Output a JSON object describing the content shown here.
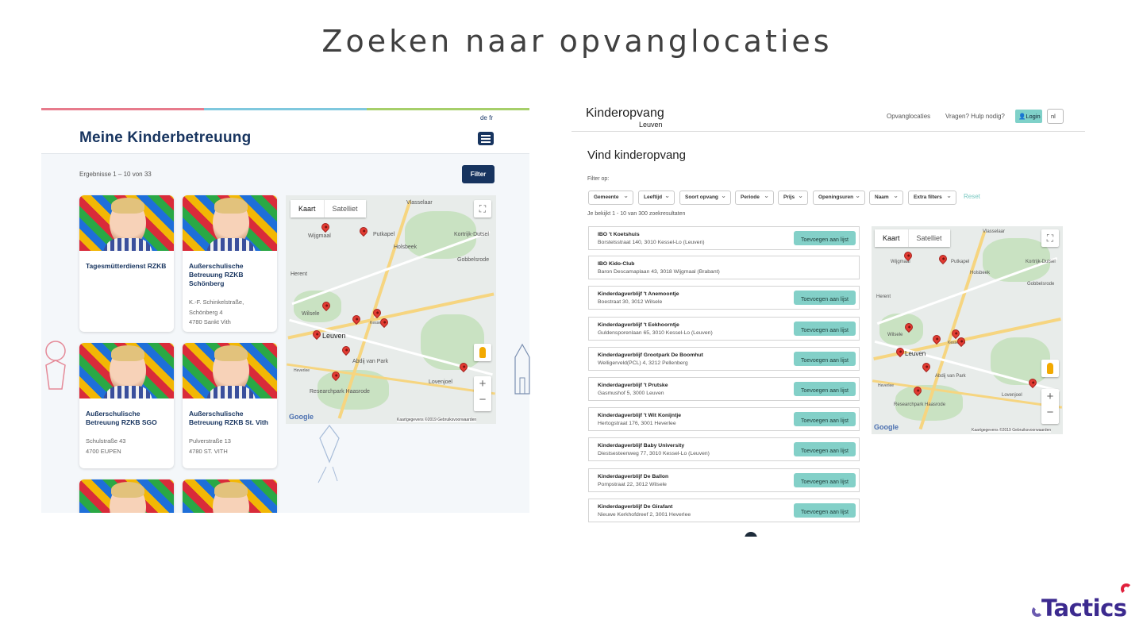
{
  "slide": {
    "title": "Zoeken naar opvanglocaties"
  },
  "left": {
    "lang_links": "de   fr",
    "title": "Meine Kinderbetreuung",
    "results": "Ergebnisse 1 – 10 von 33",
    "filter_label": "Filter",
    "cards": [
      {
        "name": "Tagesmütterdienst RZKB",
        "address": []
      },
      {
        "name": "Außerschulische Betreuung RZKB Schönberg",
        "address": [
          "K.-F. Schinkelstraße,",
          "Schönberg 4",
          "4780 Sankt Vith"
        ]
      },
      {
        "name": "Außerschulische Betreuung RZKB SGO",
        "address": [
          "Schulstraße 43",
          "4700 EUPEN"
        ]
      },
      {
        "name": "Außerschulische Betreuung RZKB St. Vith",
        "address": [
          "Pulverstraße 13",
          "4780 ST. VITH"
        ]
      },
      {
        "name": "",
        "address": []
      },
      {
        "name": "",
        "address": []
      }
    ],
    "map": {
      "tab_map": "Kaart",
      "tab_sat": "Satelliet",
      "labels": [
        "Vlasselaar",
        "Kortrijk-Dutsel",
        "Wijgmaal",
        "Putkapel",
        "Holsbeek",
        "Gobbelsrode",
        "Herent",
        "Wilsele",
        "Leuven",
        "Abdij van Park",
        "Kessel-Lo",
        "Heverlee",
        "Lovenjoel",
        "Researchpark Haasrode"
      ],
      "google": "Google",
      "copyright": "Kaartgegevens ©2019  Gebruiksvoorwaarden"
    }
  },
  "right": {
    "logo_line1": "Kinderopvang",
    "logo_line2": "Leuven",
    "nav": [
      "Opvanglocaties",
      "Vragen? Hulp nodig?"
    ],
    "login": "Login",
    "lang": "nl",
    "heading": "Vind kinderopvang",
    "filter_label": "Filter op:",
    "chips": [
      "Gemeente",
      "Leeftijd",
      "Soort opvang",
      "Periode",
      "Prijs",
      "Openingsuren",
      "Naam",
      "Extra filters"
    ],
    "reset": "Reset",
    "count": "Je bekijkt 1 - 10 van 300 zoekresultaten",
    "add_label": "Toevoegen aan lijst",
    "results": [
      {
        "name": "IBO 't Koetshuis",
        "address": "Borstelsstraat 140, 3010 Kessel-Lo (Leuven)",
        "button": true
      },
      {
        "name": "IBO Kido-Club",
        "address": "Baron Descamaplaan 43, 3018 Wijgmaal (Brabant)",
        "button": false
      },
      {
        "name": "Kinderdagverblijf 't Anemoontje",
        "address": "Boestraat 30, 3012 Wilsele",
        "button": true
      },
      {
        "name": "Kinderdagverblijf 't Eekhoorntje",
        "address": "Guldensporenlaan 65, 3010 Kessel-Lo (Leuven)",
        "button": true
      },
      {
        "name": "Kinderdagverblijf Grootpark De Boomhut",
        "address": "Welligerveld(PCL) 4, 3212 Pellenberg",
        "button": true
      },
      {
        "name": "Kinderdagverblijf 't Prutske",
        "address": "Gasmushof 5, 3000 Leuven",
        "button": true
      },
      {
        "name": "Kinderdagverblijf 't Wit Konijntje",
        "address": "Hertogstraat 176, 3001 Heverlee",
        "button": true
      },
      {
        "name": "Kinderdagverblijf Baby University",
        "address": "Diestsesteenweg 77, 3010 Kessel-Lo (Leuven)",
        "button": true
      },
      {
        "name": "Kinderdagverblijf De Ballon",
        "address": "Pompstraat 22, 3012 Wilsele",
        "button": true
      },
      {
        "name": "Kinderdagverblijf De Girafant",
        "address": "Nieuwe Kerkhofdreef 2, 3001 Heverlee",
        "button": true
      }
    ],
    "map": {
      "tab_map": "Kaart",
      "tab_sat": "Satelliet",
      "labels": [
        "Vlasselaar",
        "Wijgmaal",
        "Putkapel",
        "Kortrijk-Dutsel",
        "Holsbeek",
        "Gobbelsrode",
        "Herent",
        "Wilsele",
        "Leuven",
        "Abdij van Park",
        "Kessel-Lo",
        "Heverlee",
        "Lovenjoel",
        "Researchpark Haasrode"
      ],
      "google": "Google",
      "copyright": "Kaartgegevens ©2019  Gebruiksvoorwaarden"
    }
  },
  "logo": {
    "text": "Tactics"
  },
  "colors": {
    "navy": "#17345f",
    "teal": "#83d0c8",
    "pin": "#e23b32",
    "logo": "#3c2a8f",
    "logo_accent": "#e0203c"
  }
}
